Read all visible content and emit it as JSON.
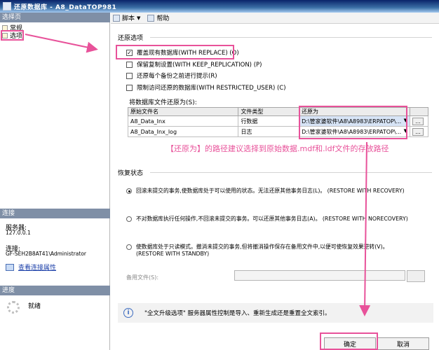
{
  "window": {
    "title": "还原数据库 - A8_DataTOP981"
  },
  "left_panel": {
    "select_page_header": "选择页",
    "pages": [
      {
        "label": "常规",
        "icon": "page-icon"
      },
      {
        "label": "选项",
        "icon": "page-icon",
        "selected": true
      }
    ],
    "connection_header": "连接",
    "server_label": "服务器:",
    "server_value": "127.0.0.1",
    "connection_label": "连接:",
    "connection_value": "GF-SEH2B8AT41\\Administrator",
    "view_props_link": "查看连接属性",
    "progress_header": "进度",
    "progress_status": "就绪"
  },
  "toolbar": {
    "script_label": "脚本",
    "help_label": "帮助"
  },
  "restore_options": {
    "group_title": "还原选项",
    "options": [
      {
        "label": "覆盖现有数据库(WITH REPLACE) (O)",
        "checked": true
      },
      {
        "label": "保留复制设置(WITH KEEP_REPLICATION) (P)",
        "checked": false
      },
      {
        "label": "还原每个备份之前进行提示(R)",
        "checked": false
      },
      {
        "label": "限制访问还原的数据库(WITH RESTRICTED_USER) (C)",
        "checked": false
      }
    ]
  },
  "files_table": {
    "label": "将数据库文件还原为(S):",
    "columns": [
      "原始文件名",
      "文件类型",
      "还原为"
    ],
    "rows": [
      {
        "name": "A8_Data_Inx",
        "type": "行数据",
        "restore_as": "D:\\管家婆软件\\A8\\A8983\\ERPATOP\\..."
      },
      {
        "name": "A8_Data_Inx_log",
        "type": "日志",
        "restore_as": "D:\\管家婆软件\\A8\\A8983\\ERPATOP\\..."
      }
    ],
    "browse_label": "..."
  },
  "annotation": "【还原为】的路径建议选择到原始数据.mdf和.ldf文件的存放路径",
  "recovery_state": {
    "group_title": "恢复状态",
    "options": [
      {
        "label": "回滚未提交的事务,使数据库处于可以使用的状态。无法还原其他事务日志(L)。 (RESTORE WITH RECOVERY)",
        "selected": true
      },
      {
        "label": "不对数据库执行任何操作,不回滚未提交的事务。可以还原其他事务日志(A)。 (RESTORE WITH NORECOVERY)",
        "selected": false
      },
      {
        "label": "使数据库处于只读模式。撤消未提交的事务,但将撤消操作保存在备用文件中,以便可使恢复效果逆转(V)。",
        "label2": "(RESTORE WITH STANDBY)",
        "selected": false
      }
    ],
    "standby_label": "备用文件(S):"
  },
  "info_text": "\"全文升级选项\" 服务器属性控制是导入、重新生成还是重置全文索引。",
  "buttons": {
    "ok": "确定",
    "cancel": "取消"
  },
  "colors": {
    "highlight": "#e8529a",
    "title_bar": "#0a246a",
    "link": "#1a3ea8"
  }
}
